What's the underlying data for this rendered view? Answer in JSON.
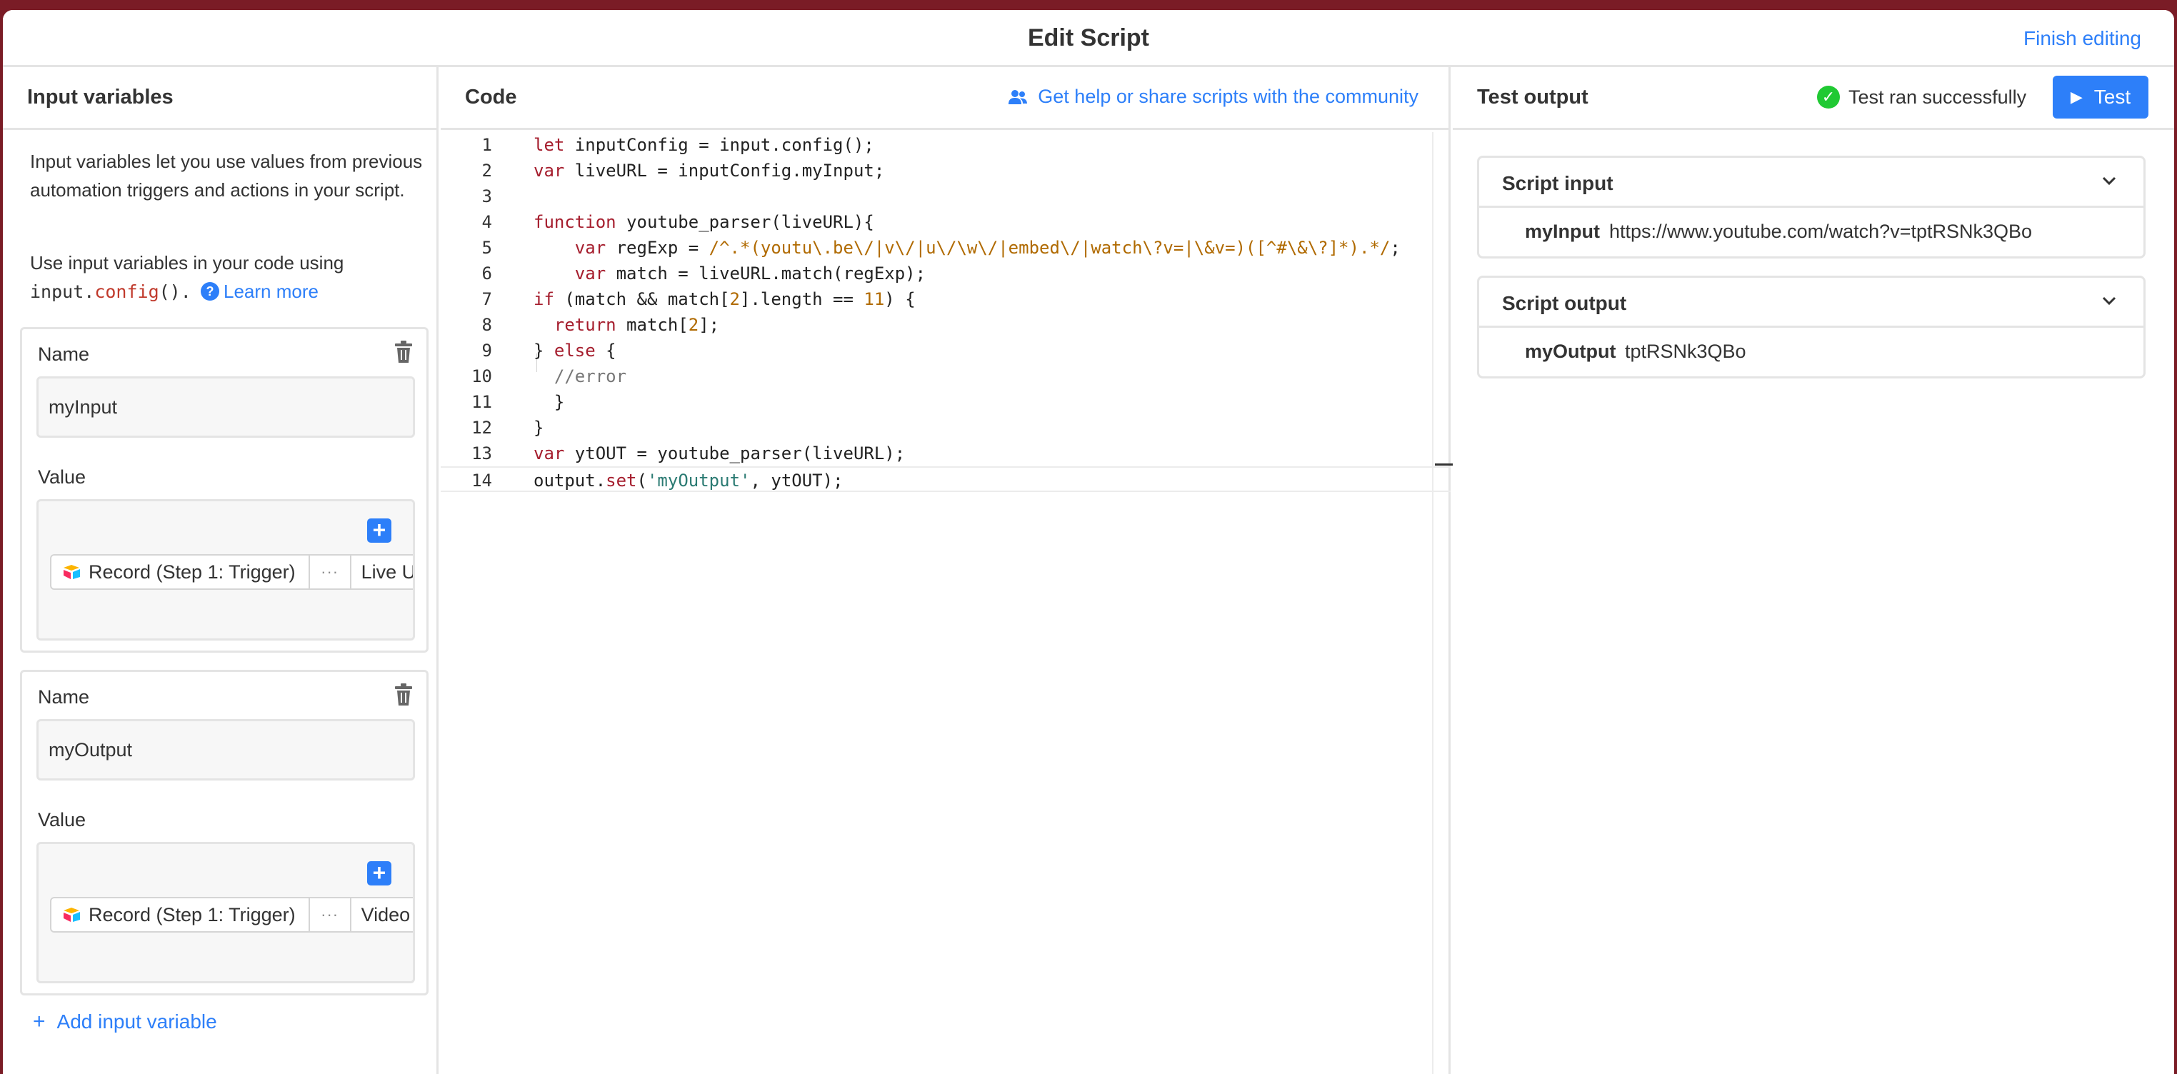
{
  "window": {
    "title": "Edit Script",
    "finish_label": "Finish editing"
  },
  "input_panel": {
    "title": "Input variables",
    "description": "Input variables let you use values from previous automation triggers and actions in your script.",
    "usage_prefix": "Use input variables in your code using",
    "usage_code_obj": "input.",
    "usage_code_fn": "config",
    "usage_code_suffix": "().",
    "learn_more": "Learn more",
    "variables": [
      {
        "name_label": "Name",
        "name_value": "myInput",
        "value_label": "Value",
        "token_source": "Record (Step 1: Trigger)",
        "token_more": "···",
        "token_field": "Live U"
      },
      {
        "name_label": "Name",
        "name_value": "myOutput",
        "value_label": "Value",
        "token_source": "Record (Step 1: Trigger)",
        "token_more": "···",
        "token_field": "Video"
      }
    ],
    "add_label": "Add input variable"
  },
  "code_panel": {
    "title": "Code",
    "community_link": "Get help or share scripts with the community",
    "line_numbers": [
      "1",
      "2",
      "3",
      "4",
      "5",
      "6",
      "7",
      "8",
      "9",
      "10",
      "11",
      "12",
      "13",
      "14"
    ]
  },
  "output_panel": {
    "title": "Test output",
    "status": "Test ran successfully",
    "test_button": "Test",
    "script_input": {
      "title": "Script input",
      "key": "myInput",
      "value": "https://www.youtube.com/watch?v=tptRSNk3QBo"
    },
    "script_output": {
      "title": "Script output",
      "key": "myOutput",
      "value": "tptRSNk3QBo"
    }
  },
  "colors": {
    "accent": "#2d7ff9",
    "success": "#20c933",
    "keyword": "#a51d2d",
    "string": "#b06a00",
    "backdrop": "#7a1c26"
  }
}
